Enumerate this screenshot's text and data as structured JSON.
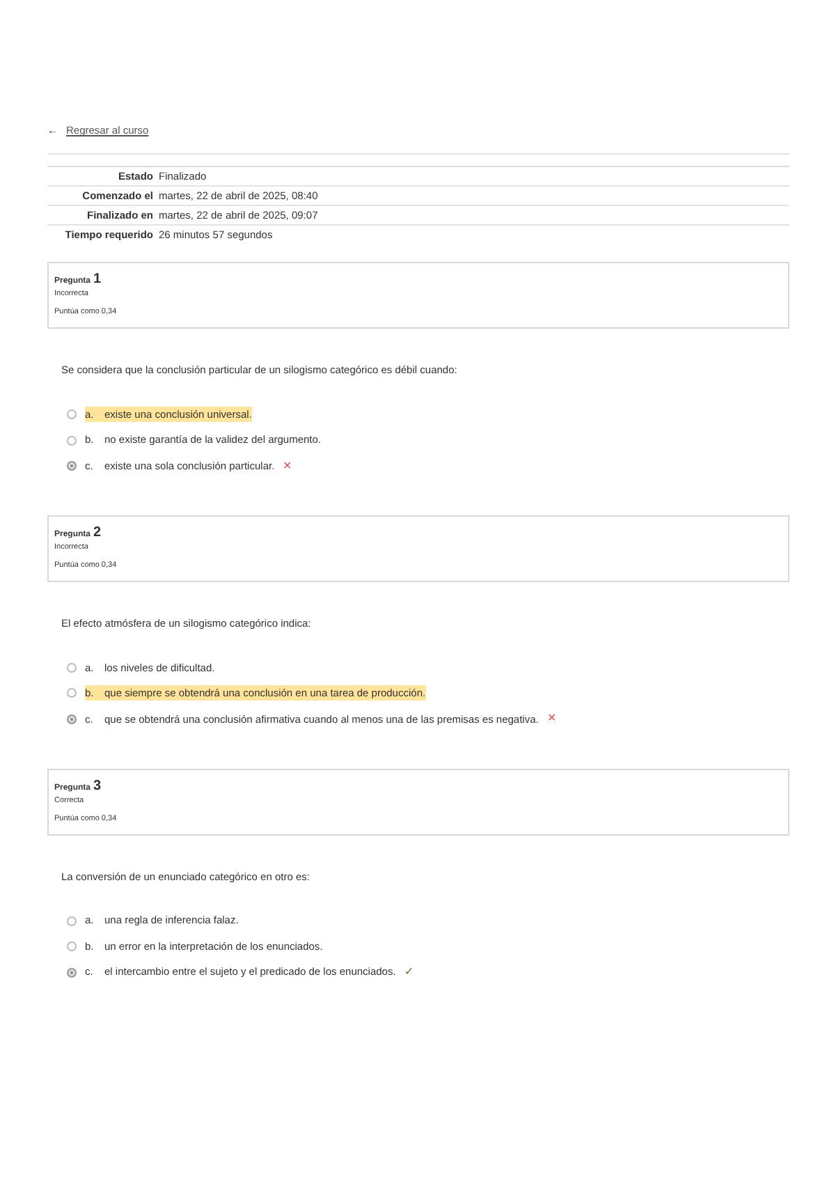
{
  "back_link": {
    "arrow": "←",
    "label": "Regresar al curso"
  },
  "summary": [
    {
      "label": "Estado",
      "value": "Finalizado"
    },
    {
      "label": "Comenzado el",
      "value": "martes, 22 de abril de 2025, 08:40"
    },
    {
      "label": "Finalizado en",
      "value": "martes, 22 de abril de 2025, 09:07"
    },
    {
      "label": "Tiempo requerido",
      "value": "26 minutos 57 segundos"
    }
  ],
  "questions": [
    {
      "label": "Pregunta",
      "number": "1",
      "status": "Incorrecta",
      "score": "Puntúa como 0,34",
      "text": "Se considera que la conclusión particular de un silogismo categórico es débil cuando:",
      "options": [
        {
          "letter": "a.",
          "text": "existe una conclusión universal.",
          "selected": false,
          "highlighted": true
        },
        {
          "letter": "b.",
          "text": "no existe garantía de la validez del argumento.",
          "selected": false,
          "highlighted": false
        },
        {
          "letter": "c.",
          "text": "existe una sola conclusión particular.",
          "selected": true,
          "highlighted": false,
          "mark": {
            "symbol": "✕",
            "kind": "incorrect"
          }
        }
      ]
    },
    {
      "label": "Pregunta",
      "number": "2",
      "status": "Incorrecta",
      "score": "Puntúa como 0,34",
      "text": "El efecto atmósfera de un silogismo categórico indica:",
      "options": [
        {
          "letter": "a.",
          "text": "los niveles de dificultad.",
          "selected": false,
          "highlighted": false
        },
        {
          "letter": "b.",
          "text": "que siempre se obtendrá una conclusión en una tarea de producción.",
          "selected": false,
          "highlighted": true
        },
        {
          "letter": "c.",
          "text": "que se obtendrá una conclusión afirmativa cuando al menos una de las premisas es negativa.",
          "selected": true,
          "highlighted": false,
          "mark": {
            "symbol": "✕",
            "kind": "incorrect"
          }
        }
      ]
    },
    {
      "label": "Pregunta",
      "number": "3",
      "status": "Correcta",
      "score": "Puntúa como 0,34",
      "text": "La conversión de un enunciado categórico en otro es:",
      "options": [
        {
          "letter": "a.",
          "text": "una regla de inferencia falaz.",
          "selected": false,
          "highlighted": false
        },
        {
          "letter": "b.",
          "text": "un error en la interpretación de los enunciados.",
          "selected": false,
          "highlighted": false
        },
        {
          "letter": "c.",
          "text": "el intercambio entre el sujeto y el predicado de los enunciados.",
          "selected": true,
          "highlighted": false,
          "mark": {
            "symbol": "✓",
            "kind": "correct"
          }
        }
      ]
    }
  ]
}
